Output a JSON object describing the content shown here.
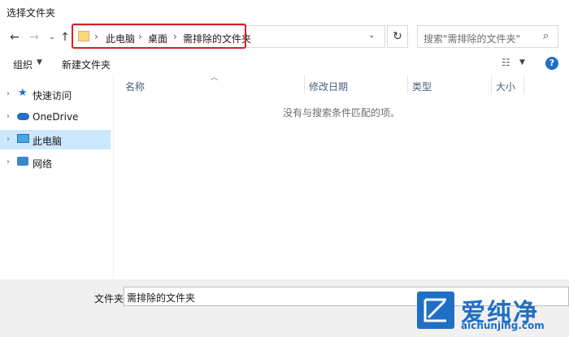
{
  "window": {
    "title": "选择文件夹"
  },
  "address": {
    "crumbs": [
      "此电脑",
      "桌面",
      "需排除的文件夹"
    ],
    "separator": "›"
  },
  "search": {
    "placeholder": "搜索\"需排除的文件夹\""
  },
  "toolbar": {
    "organize": "组织",
    "new_folder": "新建文件夹"
  },
  "nav": {
    "items": [
      {
        "label": "快速访问",
        "icon": "star-icon"
      },
      {
        "label": "OneDrive",
        "icon": "cloud-icon"
      },
      {
        "label": "此电脑",
        "icon": "computer-icon",
        "selected": true
      },
      {
        "label": "网络",
        "icon": "network-icon"
      }
    ]
  },
  "columns": [
    "名称",
    "修改日期",
    "类型",
    "大小"
  ],
  "list": {
    "empty_message": "没有与搜索条件匹配的项。"
  },
  "bottom": {
    "filename_label": "文件夹:",
    "filename_value": "需排除的文件夹"
  },
  "watermark": {
    "brand": "爱纯净",
    "url": "aichunjing.com"
  },
  "colors": {
    "accent": "#1f6fc5",
    "highlight": "#d4202a",
    "selection": "#cce8ff"
  }
}
